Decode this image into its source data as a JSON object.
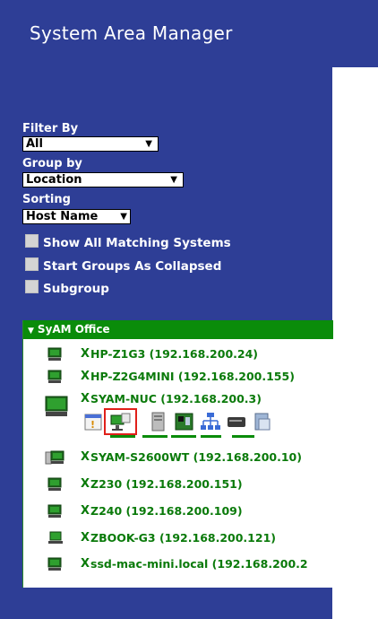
{
  "app": {
    "title": "System Area Manager"
  },
  "filters": {
    "filter_by_label": "Filter By",
    "filter_by_value": "All",
    "group_by_label": "Group by",
    "group_by_value": "Location",
    "sorting_label": "Sorting",
    "sorting_value": "Host Name"
  },
  "options": {
    "show_all": "Show All Matching Systems",
    "start_collapsed": "Start Groups As Collapsed",
    "subgroup": "Subgroup"
  },
  "tree": {
    "group_name": "SyAM Office",
    "hosts": [
      {
        "mark": "X",
        "label": "HP-Z1G3 (192.168.200.24)",
        "icon": "monitor-icon"
      },
      {
        "mark": "X",
        "label": "HP-Z2G4MINI (192.168.200.155)",
        "icon": "monitor-icon"
      },
      {
        "mark": "X",
        "label": "SYAM-NUC (192.168.200.3)",
        "icon": "monitor-icon"
      },
      {
        "mark": "X",
        "label": "SYAM-S2600WT (192.168.200.10)",
        "icon": "server-monitor-icon"
      },
      {
        "mark": "X",
        "label": "Z230 (192.168.200.151)",
        "icon": "monitor-icon"
      },
      {
        "mark": "X",
        "label": "Z240 (192.168.200.109)",
        "icon": "monitor-icon"
      },
      {
        "mark": "X",
        "label": "ZBOOK-G3 (192.168.200.121)",
        "icon": "laptop-icon"
      },
      {
        "mark": "X",
        "label": "ssd-mac-mini.local (192.168.200.2",
        "icon": "monitor-icon"
      }
    ],
    "sub_icons": [
      "calendar-alert-icon",
      "desktop-icon",
      "server-tower-icon",
      "motherboard-icon",
      "network-icon",
      "storage-icon",
      "document-icon"
    ]
  },
  "colors": {
    "sidebar": "#2e3e96",
    "accent_green": "#0a8c0a",
    "highlight_red": "#e0201a"
  }
}
